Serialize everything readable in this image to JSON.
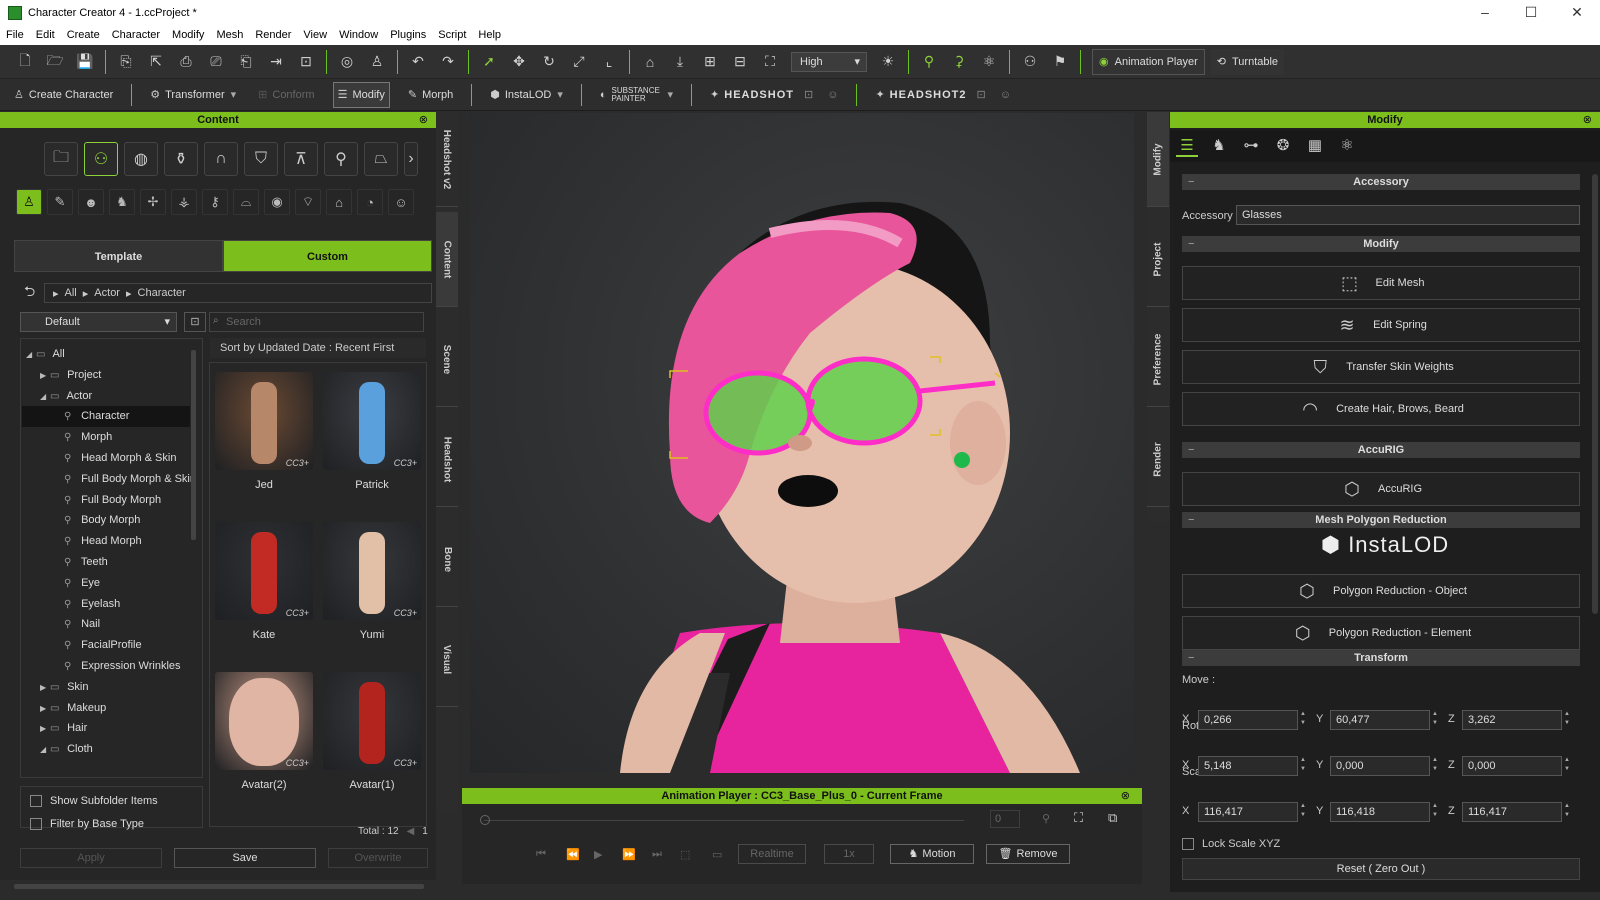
{
  "window": {
    "title": "Character Creator 4 - 1.ccProject *"
  },
  "menu": [
    "File",
    "Edit",
    "Create",
    "Character",
    "Modify",
    "Mesh",
    "Render",
    "View",
    "Window",
    "Plugins",
    "Script",
    "Help"
  ],
  "toolbar": {
    "quality": "High",
    "animation_player": "Animation Player",
    "turntable": "Turntable"
  },
  "toolbar2": {
    "create_character": "Create Character",
    "transformer": "Transformer",
    "conform": "Conform",
    "modify": "Modify",
    "morph": "Morph",
    "instalod": "InstaLOD",
    "substance": "SUBSTANCE PAINTER",
    "headshot": "HEADSHOT",
    "headshot2": "HEADSHOT2"
  },
  "content": {
    "title": "Content",
    "tabs": [
      "Template",
      "Custom"
    ],
    "breadcrumb": [
      "All",
      "Actor",
      "Character"
    ],
    "dropdown": "Default",
    "search_placeholder": "Search",
    "sort": "Sort by Updated Date : Recent First",
    "tree": [
      {
        "label": "All",
        "indent": 0,
        "arrow": "◢"
      },
      {
        "label": "Project",
        "indent": 1,
        "arrow": "▶"
      },
      {
        "label": "Actor",
        "indent": 1,
        "arrow": "◢"
      },
      {
        "label": "Character",
        "indent": 2,
        "arrow": "",
        "selected": true
      },
      {
        "label": "Morph",
        "indent": 2,
        "arrow": ""
      },
      {
        "label": "Head Morph & Skin",
        "indent": 2,
        "arrow": ""
      },
      {
        "label": "Full Body Morph & Skin",
        "indent": 2,
        "arrow": ""
      },
      {
        "label": "Full Body Morph",
        "indent": 2,
        "arrow": ""
      },
      {
        "label": "Body Morph",
        "indent": 2,
        "arrow": ""
      },
      {
        "label": "Head Morph",
        "indent": 2,
        "arrow": ""
      },
      {
        "label": "Teeth",
        "indent": 2,
        "arrow": ""
      },
      {
        "label": "Eye",
        "indent": 2,
        "arrow": ""
      },
      {
        "label": "Eyelash",
        "indent": 2,
        "arrow": ""
      },
      {
        "label": "Nail",
        "indent": 2,
        "arrow": ""
      },
      {
        "label": "FacialProfile",
        "indent": 2,
        "arrow": ""
      },
      {
        "label": "Expression Wrinkles",
        "indent": 2,
        "arrow": ""
      },
      {
        "label": "Skin",
        "indent": 1,
        "arrow": "▶"
      },
      {
        "label": "Makeup",
        "indent": 1,
        "arrow": "▶"
      },
      {
        "label": "Hair",
        "indent": 1,
        "arrow": "▶"
      },
      {
        "label": "Cloth",
        "indent": 1,
        "arrow": "◢"
      }
    ],
    "items": [
      {
        "name": "Jed",
        "bg": "#6b4a33"
      },
      {
        "name": "Patrick",
        "bg": "#3a3d42"
      },
      {
        "name": "Kate",
        "bg": "#2e3034"
      },
      {
        "name": "Yumi",
        "bg": "#35383c"
      },
      {
        "name": "Avatar(2)",
        "bg": "#c79a86"
      },
      {
        "name": "Avatar(1)",
        "bg": "#34373b"
      }
    ],
    "badge": "CC3+",
    "show_subfolder": "Show Subfolder Items",
    "filter_base": "Filter by Base Type",
    "total": "Total : 12",
    "page": "1",
    "apply": "Apply",
    "save": "Save",
    "overwrite": "Overwrite"
  },
  "side_tabs_left": [
    "Headshot v2",
    "Content",
    "Scene",
    "Headshot",
    "Bone",
    "Visual"
  ],
  "side_tabs_right": [
    "Modify",
    "Project",
    "Preference",
    "Render"
  ],
  "animation_player": {
    "title": "Animation Player : CC3_Base_Plus_0 - Current Frame",
    "frame": "0",
    "realtime": "Realtime",
    "speed": "1x",
    "motion": "Motion",
    "remove": "Remove"
  },
  "modify": {
    "title": "Modify",
    "accessory_section": "Accessory",
    "accessory_label": "Accessory",
    "accessory_value": "Glasses",
    "modify_section": "Modify",
    "edit_mesh": "Edit Mesh",
    "edit_spring": "Edit Spring",
    "transfer_skin": "Transfer Skin Weights",
    "create_hair": "Create Hair, Brows, Beard",
    "accurig_section": "AccuRIG",
    "accurig": "AccuRIG",
    "mpr_section": "Mesh Polygon Reduction",
    "instalod_logo": "InstaLOD",
    "poly_object": "Polygon Reduction - Object",
    "poly_element": "Polygon Reduction - Element",
    "transform_section": "Transform",
    "move_label": "Move :",
    "rotate_label": "Rotate :",
    "scale_label": "Scale :",
    "move": {
      "x": "0,266",
      "y": "60,477",
      "z": "3,262"
    },
    "rotate": {
      "x": "5,148",
      "y": "0,000",
      "z": "0,000"
    },
    "scale": {
      "x": "116,417",
      "y": "116,418",
      "z": "116,417"
    },
    "lock_scale": "Lock Scale XYZ",
    "reset": "Reset ( Zero Out )"
  },
  "colors": {
    "accent": "#7cbf1d",
    "panel": "#262626",
    "hair": "#e8559a",
    "glasses": "#ff2dc8",
    "lens": "#5fd04a",
    "top": "#e8239e"
  }
}
